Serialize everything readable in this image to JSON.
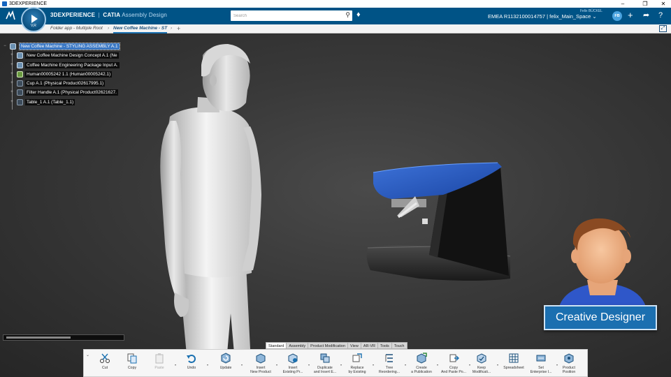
{
  "window": {
    "title": "3DEXPERIENCE",
    "controls": [
      "–",
      "❐",
      "✕"
    ]
  },
  "header": {
    "brand_bold": "3DEXPERIENCE",
    "brand_sep": "|",
    "brand_app": "CATIA",
    "brand_module": "Assembly Design",
    "compass_label": "V,R",
    "search_placeholder": "Search",
    "tenant": "EMEA R1132100014757 | felix_Main_Space ⌄",
    "user_name": "Felix BÜCKEL",
    "user_initials": "FB",
    "icons": [
      "tag-icon",
      "plus-icon",
      "share-icon",
      "help-icon"
    ]
  },
  "tabs": [
    {
      "label": "Folder app - Multiple Root",
      "active": false
    },
    {
      "label": "New Coffee Machine - ST",
      "active": true
    }
  ],
  "tree": {
    "items": [
      {
        "label": "New Coffee Machine - STYLING ASSEMBLY A.1",
        "icon": "assembly-icon",
        "root": true
      },
      {
        "label": "New Coffee Machine Design Concept A.1 (Ne",
        "icon": "assembly-icon"
      },
      {
        "label": "Coffee Machine Engineering Package Input A.",
        "icon": "assembly-icon"
      },
      {
        "label": "Human00005242 1.1 (Human00005242.1)",
        "icon": "human-icon"
      },
      {
        "label": "Cup A.1 (Physical Product02617995.1)",
        "icon": "product-icon"
      },
      {
        "label": "Filter Handle A.1 (Physical Product02621627.",
        "icon": "product-icon"
      },
      {
        "label": "Table_1 A.1 (Table_1.1)",
        "icon": "product-icon"
      }
    ]
  },
  "overlay": {
    "role_label": "Creative Designer"
  },
  "section_tabs": [
    {
      "label": "Standard",
      "active": true
    },
    {
      "label": "Assembly",
      "active": false
    },
    {
      "label": "Product Modification",
      "active": false
    },
    {
      "label": "View",
      "active": false
    },
    {
      "label": "AR-VR",
      "active": false
    },
    {
      "label": "Tools",
      "active": false
    },
    {
      "label": "Touch",
      "active": false
    }
  ],
  "commands": [
    {
      "label": "Cut",
      "icon": "cut-icon",
      "disabled": false
    },
    {
      "label": "Copy",
      "icon": "copy-icon",
      "disabled": false
    },
    {
      "label": "Paste",
      "icon": "paste-icon",
      "disabled": true
    },
    {
      "label": "Undo",
      "icon": "undo-icon",
      "disabled": false
    },
    {
      "label": "Update",
      "icon": "update-icon",
      "disabled": false
    },
    {
      "label": "Insert\nNew Product",
      "icon": "insert-new-product-icon",
      "disabled": false
    },
    {
      "label": "Insert\nExisting Pr...",
      "icon": "insert-existing-product-icon",
      "disabled": false
    },
    {
      "label": "Duplicate\nand Insert E...",
      "icon": "duplicate-insert-icon",
      "disabled": false
    },
    {
      "label": "Replace\nby Existing",
      "icon": "replace-icon",
      "disabled": false
    },
    {
      "label": "Tree\nReordering...",
      "icon": "tree-reorder-icon",
      "disabled": false
    },
    {
      "label": "Create\na Publication",
      "icon": "publication-icon",
      "disabled": false
    },
    {
      "label": "Copy\nAnd Paste Po...",
      "icon": "copy-paste-position-icon",
      "disabled": false
    },
    {
      "label": "Keep\nModificati...",
      "icon": "keep-modification-icon",
      "disabled": false
    },
    {
      "label": "Spreadsheet",
      "icon": "spreadsheet-icon",
      "disabled": false
    },
    {
      "label": "Set\nEnterprise I...",
      "icon": "enterprise-icon",
      "disabled": false
    },
    {
      "label": "Product\nPosition",
      "icon": "product-position-icon",
      "disabled": false
    }
  ],
  "colors": {
    "header_blue": "#005386",
    "accent_blue": "#1b6fb0",
    "machine_blue": "#2a5bbf"
  }
}
